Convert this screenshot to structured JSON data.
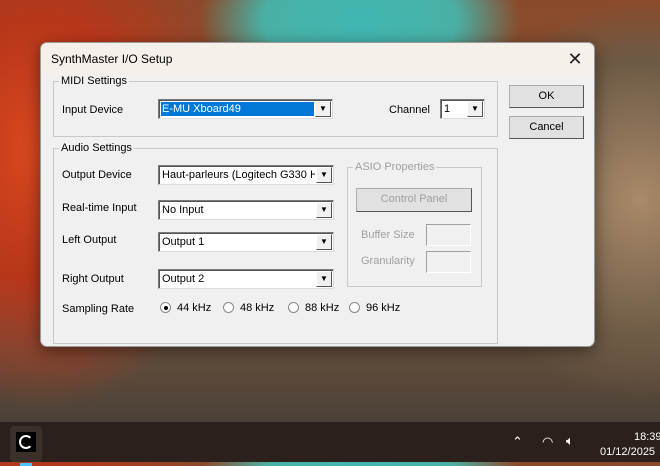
{
  "dialog": {
    "title": "SynthMaster I/O Setup"
  },
  "midi": {
    "legend": "MIDI Settings",
    "input_device_label": "Input Device",
    "input_device_value": "E-MU Xboard49",
    "channel_label": "Channel",
    "channel_value": "1"
  },
  "buttons": {
    "ok": "OK",
    "cancel": "Cancel"
  },
  "audio": {
    "legend": "Audio Settings",
    "output_device_label": "Output Device",
    "output_device_value": "Haut-parleurs (Logitech G330 He",
    "realtime_input_label": "Real-time Input",
    "realtime_input_value": "No Input",
    "left_output_label": "Left Output",
    "left_output_value": "Output 1",
    "right_output_label": "Right Output",
    "right_output_value": "Output 2",
    "sampling_rate_label": "Sampling Rate",
    "sampling_rates": [
      "44 kHz",
      "48 kHz",
      "88 kHz",
      "96 kHz"
    ],
    "selected_rate": "44 kHz"
  },
  "asio": {
    "legend": "ASIO Properties",
    "control_panel": "Control Panel",
    "buffer_size_label": "Buffer Size",
    "granularity_label": "Granularity"
  },
  "taskbar": {
    "time": "18:39",
    "date": "01/12/2025"
  },
  "colors": {
    "selection": "#0078d7"
  }
}
